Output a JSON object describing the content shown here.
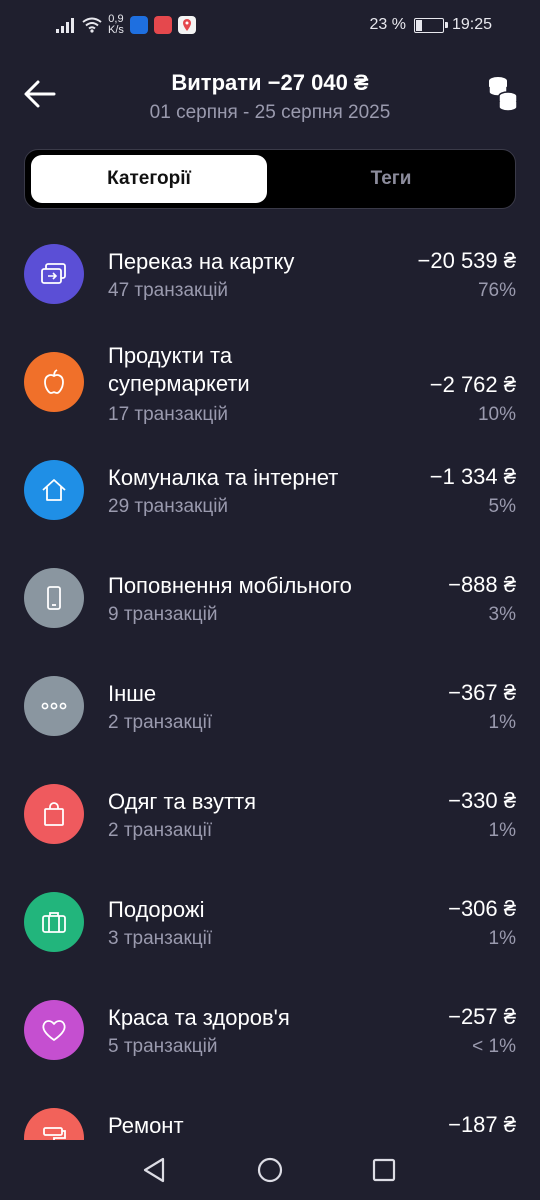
{
  "status_bar": {
    "net_speed_value": "0,9",
    "net_speed_unit": "K/s",
    "battery_percent": "23 %",
    "battery_level": 0.23,
    "time": "19:25"
  },
  "header": {
    "title": "Витрати −27 040 ₴",
    "date_range": "01 серпня - 25 серпня 2025"
  },
  "tabs": {
    "categories": "Категорії",
    "tags": "Теги",
    "active": "categories"
  },
  "categories": [
    {
      "name": "Переказ на картку",
      "count": "47 транзакцій",
      "amount": "−20 539 ₴",
      "percent": "76%",
      "icon": "card-transfer-icon",
      "color": "#5b4fd6"
    },
    {
      "name": "Продукти та супермаркети",
      "count": "17 транзакцій",
      "amount": "−2 762 ₴",
      "percent": "10%",
      "icon": "apple-icon",
      "color": "#f0702a"
    },
    {
      "name": "Комуналка та інтернет",
      "count": "29 транзакцій",
      "amount": "−1 334 ₴",
      "percent": "5%",
      "icon": "house-icon",
      "color": "#1f8fe6"
    },
    {
      "name": "Поповнення мобільного",
      "count": "9 транзакцій",
      "amount": "−888 ₴",
      "percent": "3%",
      "icon": "phone-icon",
      "color": "#8a96a0"
    },
    {
      "name": "Інше",
      "count": "2 транзакції",
      "amount": "−367 ₴",
      "percent": "1%",
      "icon": "more-dots-icon",
      "color": "#8a96a0"
    },
    {
      "name": "Одяг та взуття",
      "count": "2 транзакції",
      "amount": "−330 ₴",
      "percent": "1%",
      "icon": "shopping-bag-icon",
      "color": "#ef5a5e"
    },
    {
      "name": "Подорожі",
      "count": "3 транзакції",
      "amount": "−306 ₴",
      "percent": "1%",
      "icon": "suitcase-icon",
      "color": "#22b57c"
    },
    {
      "name": "Краса та здоров'я",
      "count": "5 транзакцій",
      "amount": "−257 ₴",
      "percent": "< 1%",
      "icon": "heart-icon",
      "color": "#c54fd0"
    },
    {
      "name": "Ремонт",
      "count": "",
      "amount": "−187 ₴",
      "percent": "",
      "icon": "paint-roller-icon",
      "color": "#f2625a"
    }
  ]
}
